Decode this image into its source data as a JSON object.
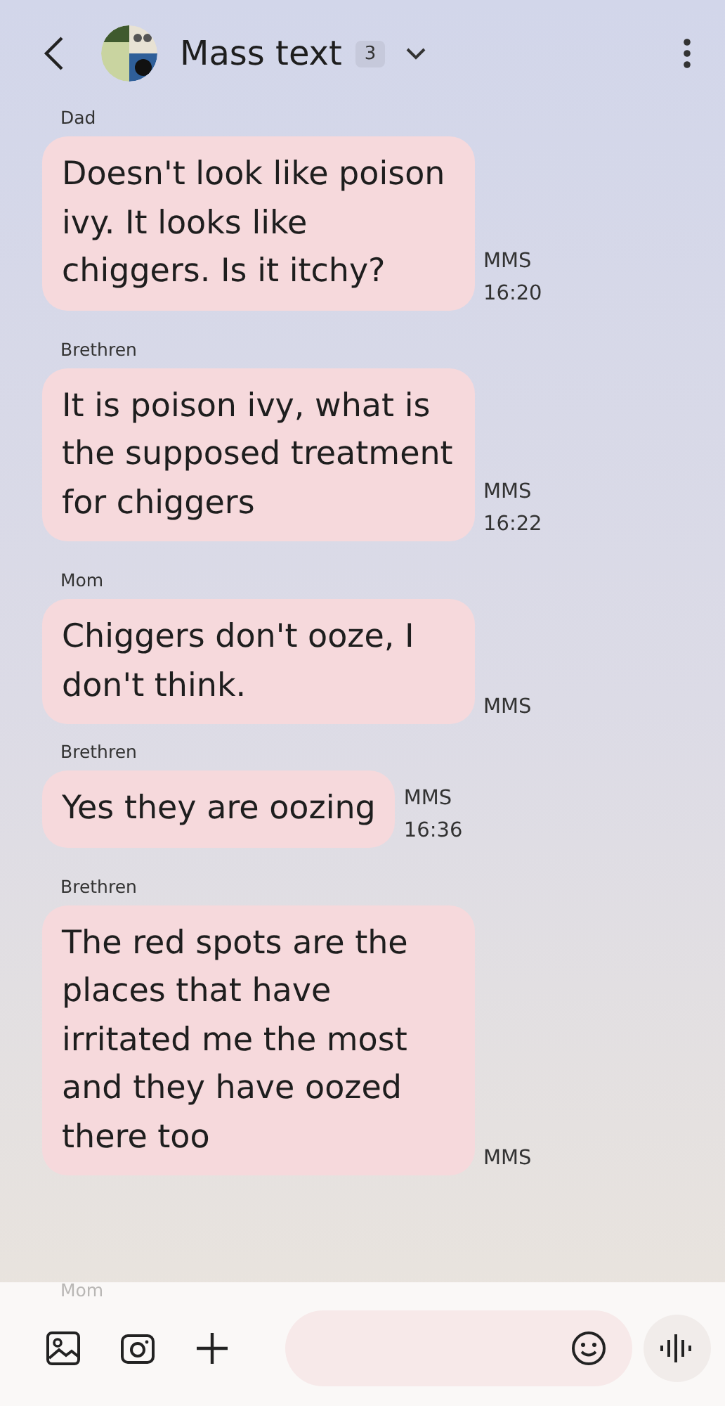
{
  "header": {
    "title": "Mass text",
    "member_count": "3"
  },
  "messages": [
    {
      "sender": "Dad",
      "text": "Doesn't look like poison ivy. It looks like chiggers. Is it itchy?",
      "type": "MMS",
      "time": "16:20"
    },
    {
      "sender": "Brethren",
      "text": "It is poison ivy, what is the supposed treatment for chiggers",
      "type": "MMS",
      "time": "16:22"
    },
    {
      "sender": "Mom",
      "text": "Chiggers don't ooze, I don't think.",
      "type": "MMS"
    },
    {
      "sender": "Brethren",
      "text": "Yes they are oozing",
      "type": "MMS",
      "time": "16:36"
    },
    {
      "sender": "Brethren",
      "text": "The red spots are the places that have irritated me the most and they have oozed there too",
      "type": "MMS"
    }
  ],
  "behind_composer": {
    "sender": "Mom"
  }
}
